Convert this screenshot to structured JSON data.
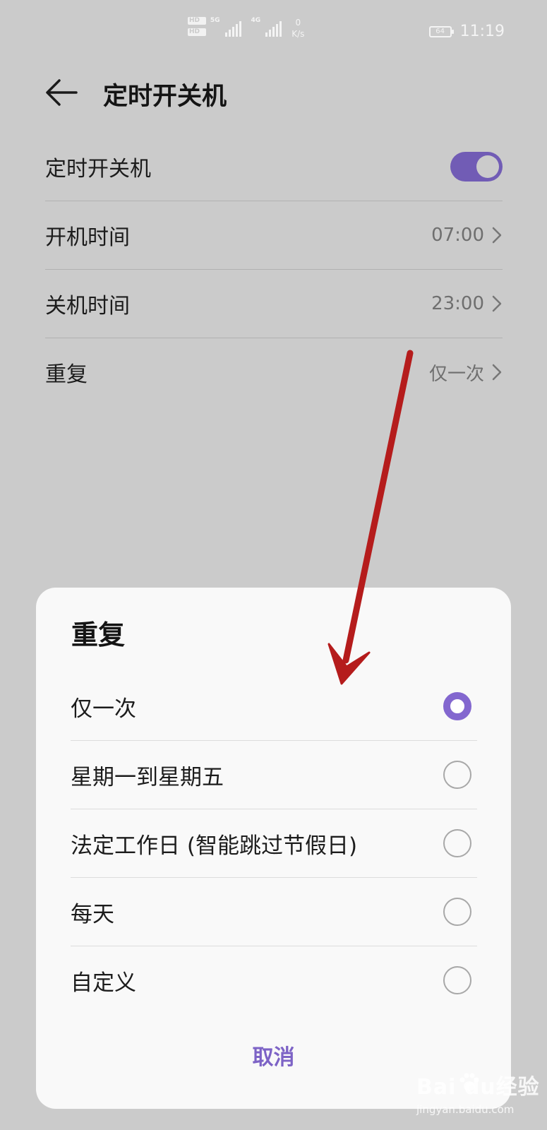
{
  "status_bar": {
    "hd1": "HD",
    "hd1_sub": "1",
    "hd2": "HD",
    "hd2_sub": "2",
    "net1": "5G",
    "net2": "4G",
    "speed_value": "0",
    "speed_unit": "K/s",
    "battery": "64",
    "time": "11:19"
  },
  "header": {
    "title": "定时开关机",
    "back_icon": "arrow-left-icon"
  },
  "settings": {
    "toggle_row": {
      "label": "定时开关机",
      "enabled": true
    },
    "rows": [
      {
        "label": "开机时间",
        "value": "07:00"
      },
      {
        "label": "关机时间",
        "value": "23:00"
      },
      {
        "label": "重复",
        "value": "仅一次"
      }
    ],
    "chevron_icon": "chevron-right-icon"
  },
  "dialog": {
    "title": "重复",
    "options": [
      {
        "label": "仅一次",
        "selected": true
      },
      {
        "label": "星期一到星期五",
        "selected": false
      },
      {
        "label": "法定工作日 (智能跳过节假日)",
        "selected": false
      },
      {
        "label": "每天",
        "selected": false
      },
      {
        "label": "自定义",
        "selected": false
      }
    ],
    "cancel_label": "取消"
  },
  "colors": {
    "accent": "#715cb5",
    "radio_selected": "#8367cf",
    "cancel_text": "#7d63c6",
    "annotation_arrow": "#b51c1c",
    "dim_background": "#cbcbcb",
    "sheet_background": "#f9f9f9"
  },
  "watermark": {
    "brand": "Bai  du经验",
    "sub": "jingyan.baidu.com"
  }
}
